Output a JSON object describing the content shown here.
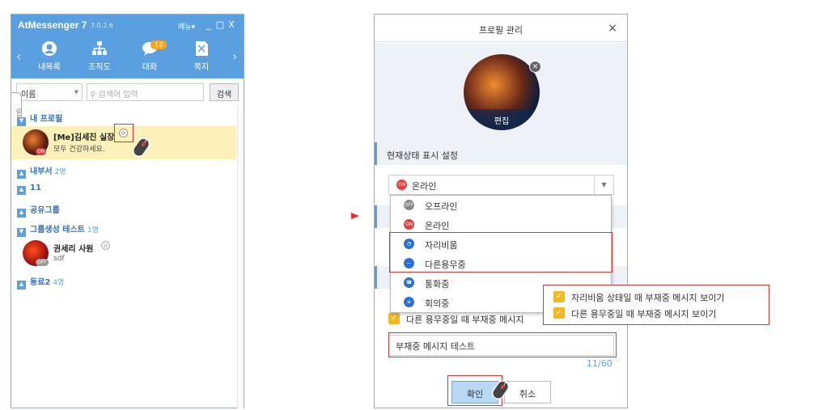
{
  "messenger": {
    "app_title": "AtMessenger 7",
    "version": "7.0.2.6",
    "menu_label": "메뉴",
    "window_buttons": [
      "_",
      "□",
      "X"
    ],
    "nav": [
      {
        "label": "내목록",
        "icon": "person-icon"
      },
      {
        "label": "조직도",
        "icon": "org-chart-icon"
      },
      {
        "label": "대화",
        "icon": "chat-icon",
        "badge": "12"
      },
      {
        "label": "쪽지",
        "icon": "note-icon"
      }
    ],
    "search": {
      "select_value": "이름",
      "placeholder": "검색어 입력",
      "button": "검색"
    },
    "quick_menu": "QUICK MENU",
    "my_profile_section": "내 프로필",
    "me": {
      "name": "[Me]김세진 실장",
      "status_msg": "모두 건강하세요.",
      "status_tag": "ON"
    },
    "groups": [
      {
        "label": "내부서",
        "count": "2명"
      },
      {
        "label": "11",
        "count": ""
      },
      {
        "label": "공유그룹",
        "count": ""
      },
      {
        "label": "그룹생성 테스트",
        "count": "1명"
      }
    ],
    "member": {
      "name": "권세리 사원",
      "status_msg": "sdf",
      "status_tag": "OFF"
    },
    "last_group": {
      "label": "동료2",
      "count": "4명"
    }
  },
  "dialog": {
    "title": "프로필 관리",
    "close": "×",
    "photo_edit": "편집",
    "section_status": "현재상태 표시 설정",
    "selected_status": "온라인",
    "selected_tag": "ON",
    "dropdown": [
      {
        "label": "오프라인",
        "tag": "OFF",
        "color": "#888888"
      },
      {
        "label": "온라인",
        "tag": "ON",
        "color": "#e04040"
      },
      {
        "label": "자리비움",
        "tag": "",
        "color": "#2b6fd0"
      },
      {
        "label": "다른용무중",
        "tag": "",
        "color": "#2b6fd0"
      },
      {
        "label": "통화중",
        "tag": "",
        "color": "#2b6fd0"
      },
      {
        "label": "회의중",
        "tag": "",
        "color": "#2b6fd0"
      }
    ],
    "partial_checkbox_label": "다른 용무중일 때 부재중 메시지",
    "message_value": "부재중 메시지 테스트",
    "counter": "11/60",
    "ok": "확인",
    "cancel": "취소"
  },
  "popup": {
    "options": [
      "자리비움 상태일 때 부재중 메시지 보이기",
      "다른 용무중일 때 부재중 메시지 보이기"
    ]
  },
  "colors": {
    "accent": "#5aa0e0",
    "highlight": "#fdf0b8",
    "callout": "#dd3333"
  }
}
